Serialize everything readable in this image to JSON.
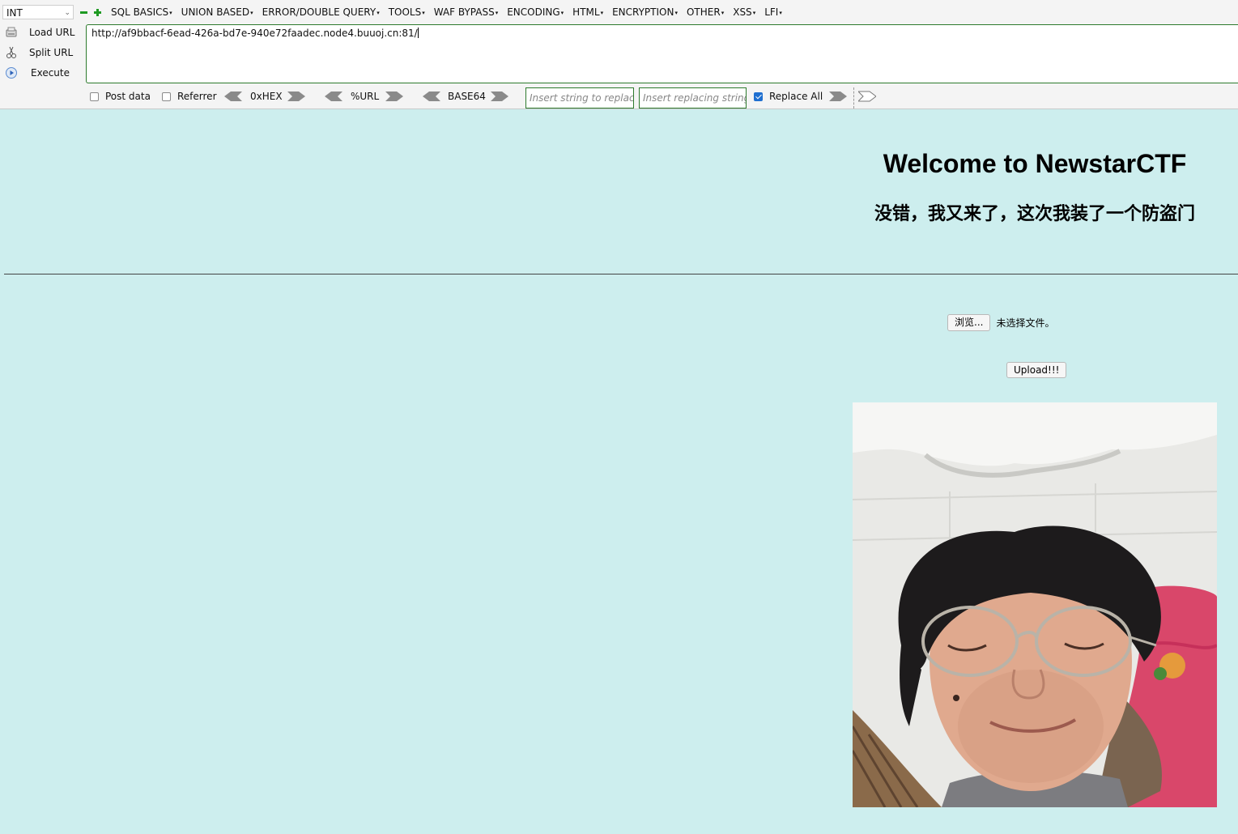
{
  "hackbar": {
    "type_select": "INT",
    "menus": [
      {
        "label": "SQL BASICS"
      },
      {
        "label": "UNION BASED"
      },
      {
        "label": "ERROR/DOUBLE QUERY"
      },
      {
        "label": "TOOLS"
      },
      {
        "label": "WAF BYPASS"
      },
      {
        "label": "ENCODING"
      },
      {
        "label": "HTML"
      },
      {
        "label": "ENCRYPTION"
      },
      {
        "label": "OTHER"
      },
      {
        "label": "XSS"
      },
      {
        "label": "LFI"
      }
    ],
    "commands": {
      "load_url": "Load URL",
      "split_url": "Split URL",
      "execute": "Execute"
    },
    "url": "http://af9bbacf-6ead-426a-bd7e-940e72faadec.node4.buuoj.cn:81/",
    "options": {
      "post_data": "Post data",
      "referrer": "Referrer",
      "hex": "0xHEX",
      "url_enc": "%URL",
      "base64": "BASE64",
      "replace_placeholder": "Insert string to replace",
      "replacing_placeholder": "Insert replacing string",
      "replace_all": "Replace All"
    }
  },
  "page": {
    "title": "Welcome to NewstarCTF",
    "subtitle": "没错，我又来了，这次我装了一个防盗门",
    "browse_button": "浏览...",
    "file_status": "未选择文件。",
    "upload_button": "Upload!!!"
  }
}
